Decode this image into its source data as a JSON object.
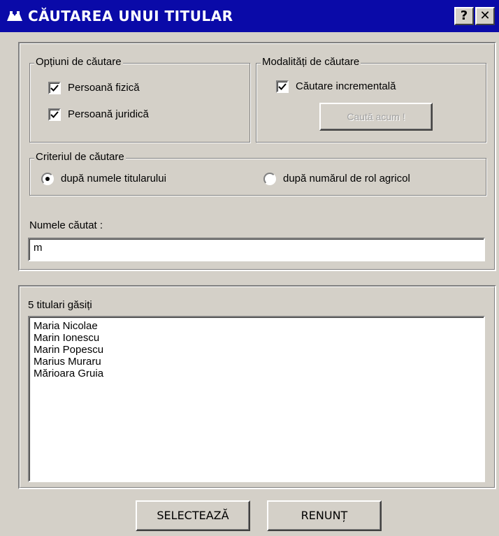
{
  "window": {
    "title": "CĂUTAREA UNUI TITULAR",
    "help_button": "?",
    "close_button": "✕"
  },
  "search_options": {
    "legend": "Opțiuni de căutare",
    "person_physical": {
      "label": "Persoană fizică",
      "checked": true
    },
    "person_legal": {
      "label": "Persoană juridică",
      "checked": true
    }
  },
  "search_modes": {
    "legend": "Modalități de căutare",
    "incremental": {
      "label": "Căutare incrementală",
      "checked": true
    },
    "search_now_button": "Caută acum !"
  },
  "criteria": {
    "legend": "Criteriul de căutare",
    "by_name": {
      "label": "după numele titularului",
      "selected": true
    },
    "by_role": {
      "label": "după numărul de rol agricol",
      "selected": false
    }
  },
  "search_field": {
    "label": "Numele căutat :",
    "value": "m"
  },
  "results": {
    "count_label": "5 titulari găsiți",
    "items": [
      "Maria Nicolae",
      "Marin Ionescu",
      "Marin Popescu",
      "Marius Muraru",
      "Mărioara Gruia"
    ]
  },
  "buttons": {
    "select": "SELECTEAZĂ",
    "cancel": "RENUNȚ"
  }
}
